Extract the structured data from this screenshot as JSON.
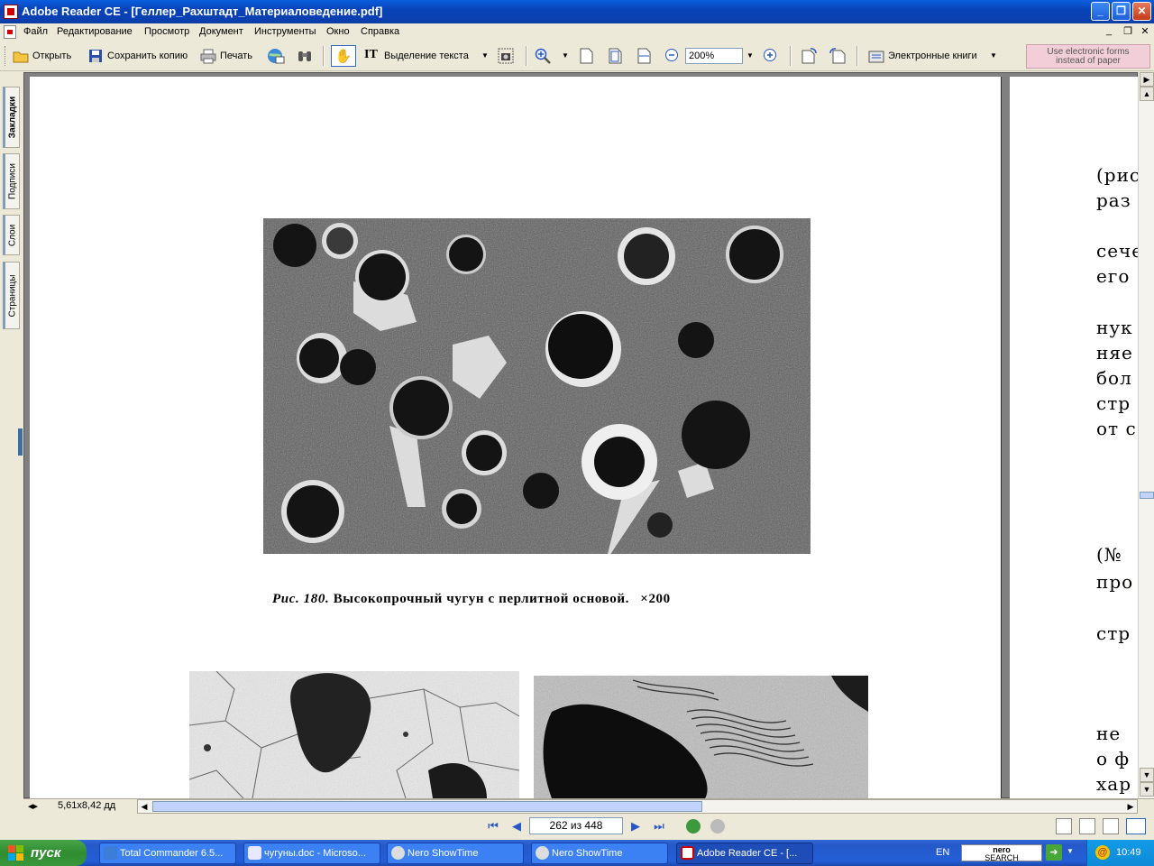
{
  "window": {
    "title": "Adobe Reader CE - [Геллер_Рахштадт_Материаловедение.pdf]",
    "controls": [
      "_",
      "❐",
      "✕"
    ]
  },
  "menu": {
    "items": [
      "Файл",
      "Редактирование",
      "Просмотр",
      "Документ",
      "Инструменты",
      "Окно",
      "Справка"
    ],
    "mdi_controls": [
      "_",
      "❐",
      "✕"
    ]
  },
  "toolbar": {
    "open_label": "Открыть",
    "save_copy_label": "Сохранить копию",
    "print_label": "Печать",
    "select_text_label": "Выделение текста",
    "zoom_value": "200%",
    "ebooks_label": "Электронные книги",
    "forms_line1": "Use electronic forms",
    "forms_line2": "instead of paper"
  },
  "side_tabs": [
    "Закладки",
    "Подписи",
    "Слои",
    "Страницы"
  ],
  "document": {
    "caption_prefix": "Рис. 180.",
    "caption_text": "Высокопрочный чугун с перлитной основой.",
    "caption_mag": "×200",
    "right_page_lines": [
      "(рис",
      "раз",
      "сече",
      "его",
      "нук",
      "няе",
      "бол",
      "стр",
      "от с",
      "(№",
      "про",
      "стр",
      "не",
      "о ф",
      "хар"
    ]
  },
  "status": {
    "page_size": "5,61x8,42 дд",
    "page_field": "262 из 448"
  },
  "taskbar": {
    "start_label": "пуск",
    "tasks": [
      "Total Commander 6.5...",
      "чугуны.doc - Microso...",
      "Nero ShowTime",
      "Nero ShowTime",
      "Adobe Reader CE - [..."
    ],
    "language": "EN",
    "nero_search_line1": "nero",
    "nero_search_line2": "SEARCH",
    "clock": "10:49"
  }
}
